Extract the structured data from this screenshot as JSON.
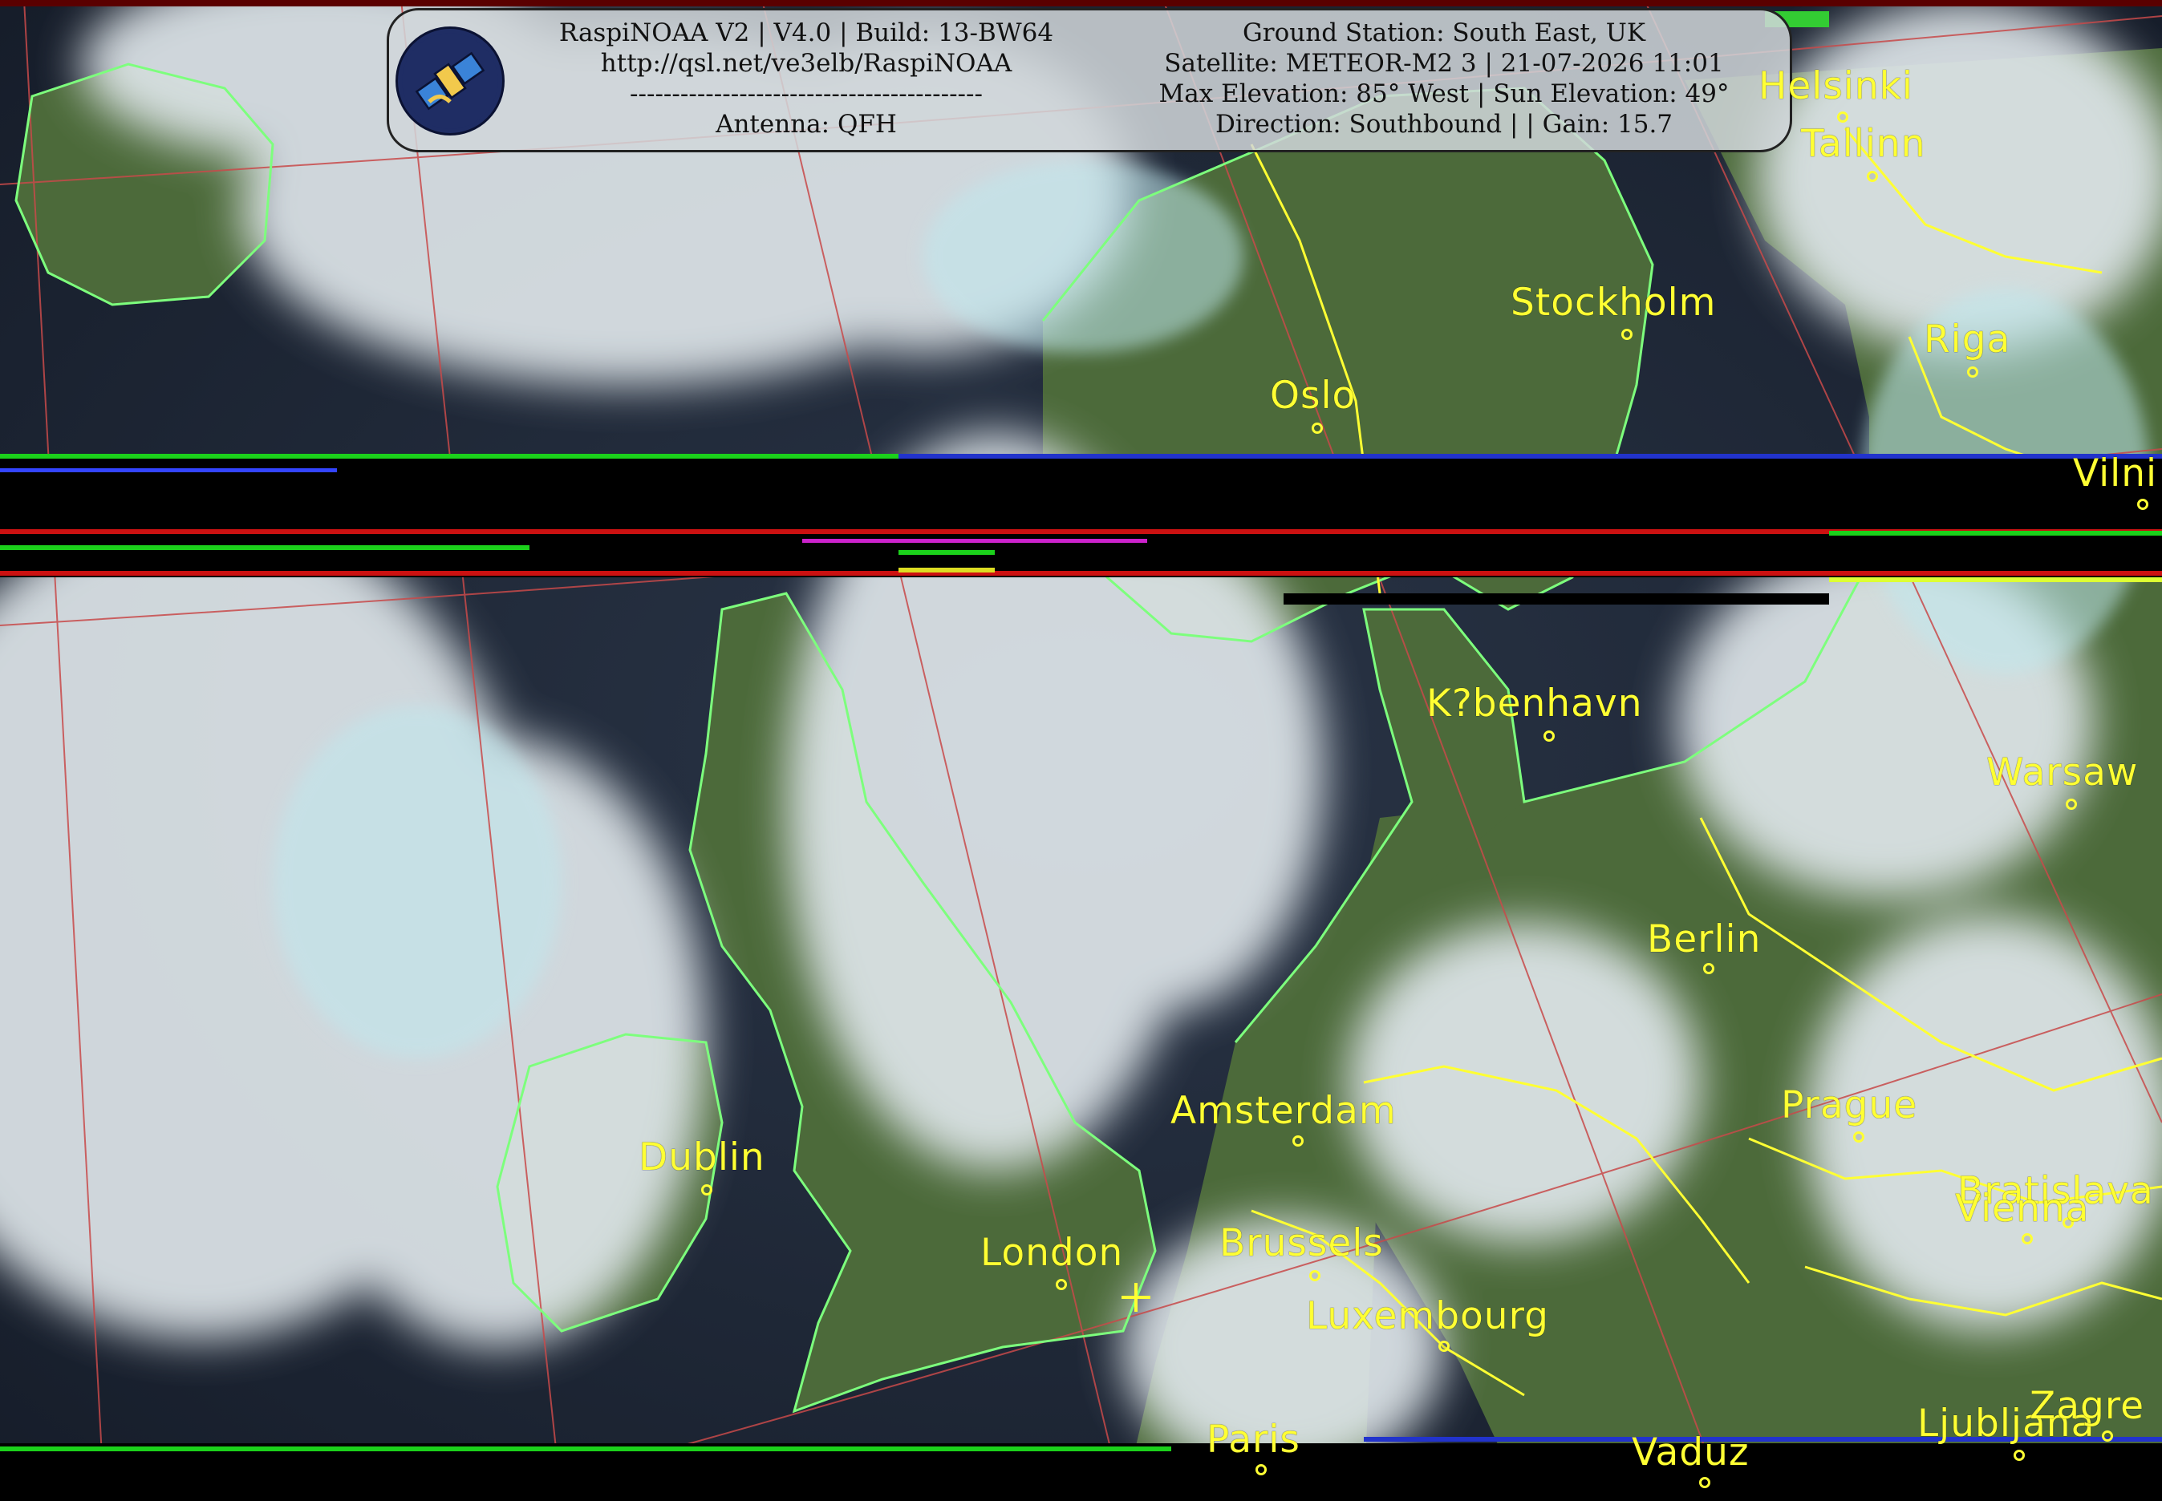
{
  "info": {
    "left_lines": [
      "RaspiNOAA V2 | V4.0 | Build: 13-BW64",
      "http://qsl.net/ve3elb/RaspiNOAA",
      "------------------------------------------",
      "Antenna: QFH"
    ],
    "right_lines": [
      "Ground Station: South East, UK",
      "Satellite: METEOR-M2 3 | 21-07-2026 11:01",
      "Max Elevation: 85° West | Sun Elevation: 49°",
      "Direction: Southbound | | Gain: 15.7"
    ]
  },
  "icons": {
    "logo": "satellite-icon",
    "station": "ground-station-crosshair-icon"
  },
  "colors": {
    "city_label": "#ffff33",
    "borders": "#ffff33",
    "coastline": "#7dff7d",
    "graticule": "#c84a4a"
  },
  "cities": [
    {
      "name": "Helsinki"
    },
    {
      "name": "Tallinn"
    },
    {
      "name": "Stockholm"
    },
    {
      "name": "Riga"
    },
    {
      "name": "Oslo"
    },
    {
      "name": "Vilni"
    },
    {
      "name": "K?benhavn"
    },
    {
      "name": "Warsaw"
    },
    {
      "name": "Berlin"
    },
    {
      "name": "Dublin"
    },
    {
      "name": "Amsterdam"
    },
    {
      "name": "Prague"
    },
    {
      "name": "London"
    },
    {
      "name": "Brussels"
    },
    {
      "name": "Bratislava"
    },
    {
      "name": "Vienna"
    },
    {
      "name": "Luxembourg"
    },
    {
      "name": "Paris"
    },
    {
      "name": "Vaduz"
    },
    {
      "name": "Ljubljana"
    },
    {
      "name": "Zagre"
    }
  ]
}
